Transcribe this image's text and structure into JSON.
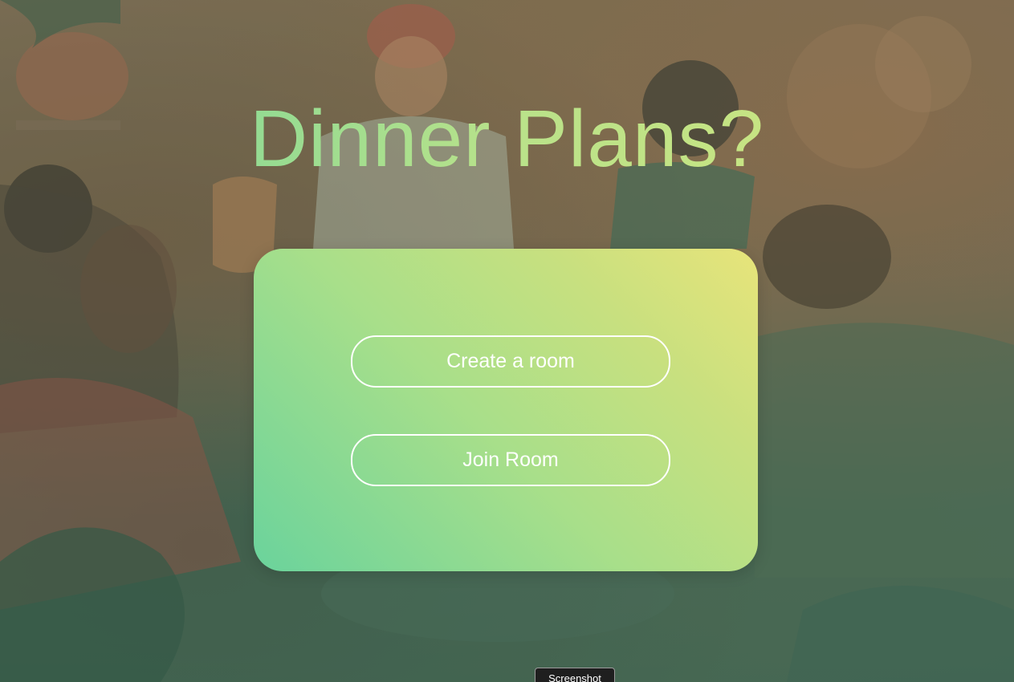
{
  "page": {
    "title": "Dinner Plans?"
  },
  "actions": {
    "create_label": "Create a room",
    "join_label": "Join Room"
  },
  "overlay_badge": {
    "label": "Screenshot"
  },
  "colors": {
    "title_gradient_start": "#6fd49a",
    "title_gradient_end": "#d4e67c",
    "card_gradient_start": "#6ad39c",
    "card_gradient_end": "#e8e47a",
    "button_border": "#ffffff"
  },
  "background": {
    "description_icon": "dinner-party-illustration"
  }
}
